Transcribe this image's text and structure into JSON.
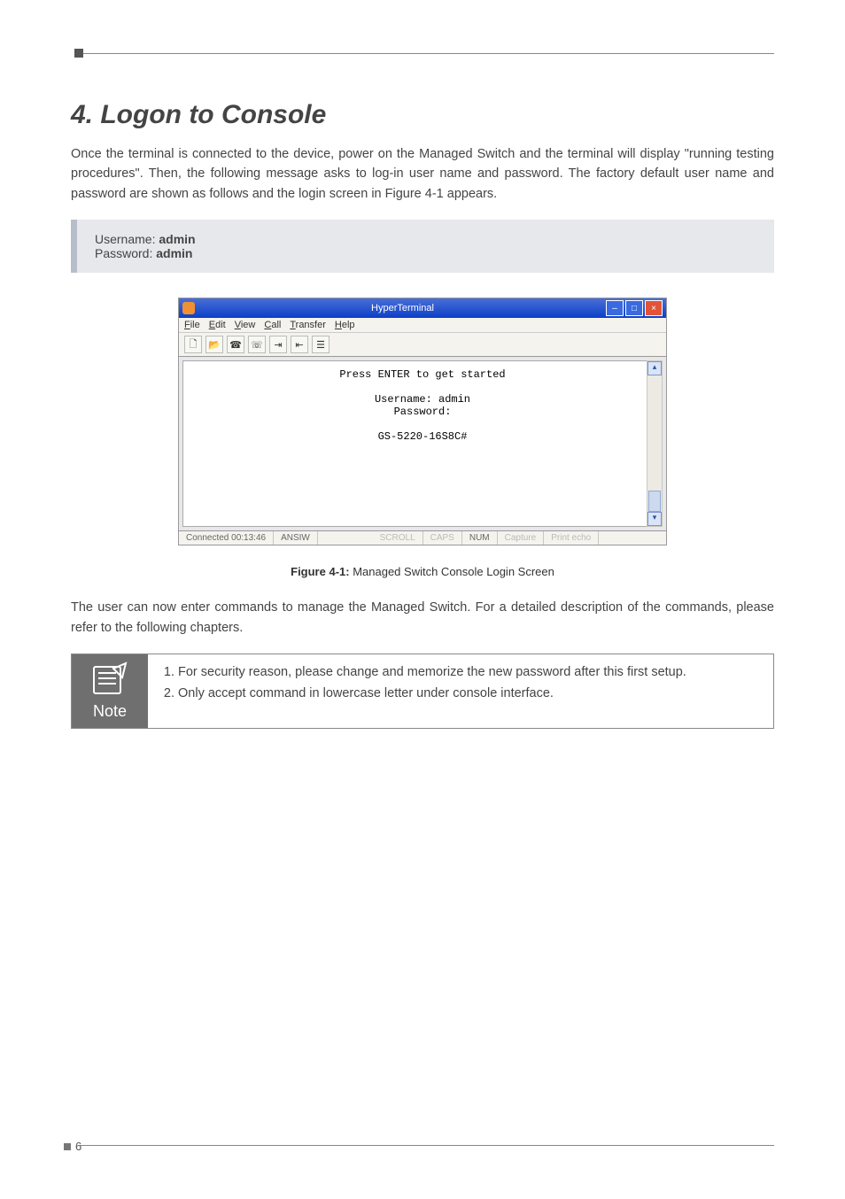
{
  "heading": "4. Logon to Console",
  "intro": "Once the terminal is connected to the device, power on the Managed Switch and the terminal will display \"running testing procedures\". Then, the following message asks to log-in user name and password. The factory default user name and password are shown as follows and the login screen in Figure 4-1 appears.",
  "credentials": {
    "user_label": "Username: ",
    "user_value": "admin",
    "pass_label": "Password: ",
    "pass_value": "admin"
  },
  "terminal_window": {
    "title": "HyperTerminal",
    "menus": [
      "File",
      "Edit",
      "View",
      "Call",
      "Transfer",
      "Help"
    ],
    "content": "Press ENTER to get started\n\nUsername: admin\nPassword:\n\nGS-5220-16S8C#",
    "status": {
      "connected": "Connected 00:13:46",
      "encoding": "ANSIW",
      "scroll": "SCROLL",
      "caps": "CAPS",
      "num": "NUM",
      "capture": "Capture",
      "printecho": "Print echo"
    }
  },
  "figure_caption_bold": "Figure 4-1:",
  "figure_caption_rest": " Managed Switch Console Login Screen",
  "after_figure": "The user can now enter commands to manage the Managed Switch. For a detailed description of the commands, please refer to the following chapters.",
  "note": {
    "label": "Note",
    "items": [
      "For security reason, please change and memorize the new password after this first setup.",
      "Only accept command in lowercase letter under console interface."
    ]
  },
  "page_number": "6"
}
